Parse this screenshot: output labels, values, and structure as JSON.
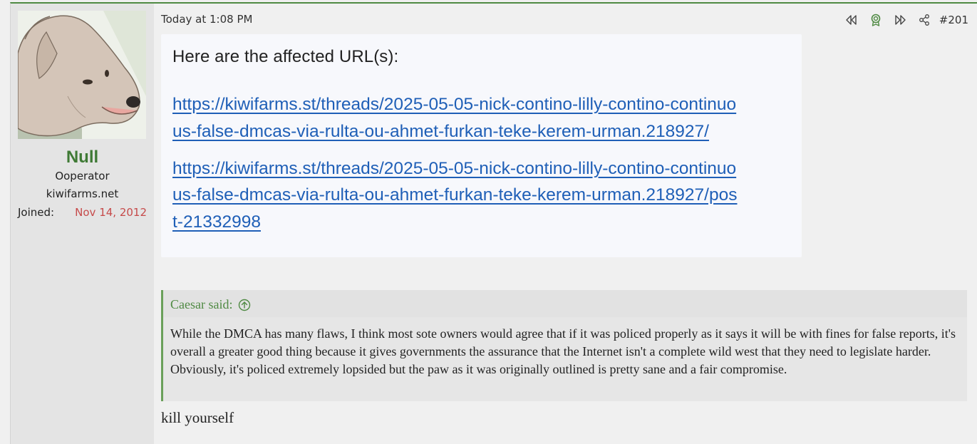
{
  "user": {
    "name": "Null",
    "title": "Ooperator",
    "site": "kiwifarms.net",
    "joined_label": "Joined:",
    "joined_value": "Nov 14, 2012"
  },
  "post": {
    "timestamp": "Today at 1:08 PM",
    "number": "#201",
    "icons": [
      "rewind-icon",
      "award-icon",
      "fast-forward-icon",
      "share-icon"
    ],
    "embed": {
      "heading": "Here are the affected URL(s):",
      "link1_line1": "https://kiwifarms.st/threads/2025-05-05-nick-contino-lilly-contino-continuo",
      "link1_line2": "us-false-dmcas-via-rulta-ou-ahmet-furkan-teke-kerem-urman.218927/",
      "link2_line1": "https://kiwifarms.st/threads/2025-05-05-nick-contino-lilly-contino-continuo",
      "link2_line2": "us-false-dmcas-via-rulta-ou-ahmet-furkan-teke-kerem-urman.218927/pos",
      "link2_line3": "t-21332998"
    },
    "quote": {
      "author": "Caesar said:",
      "text": "While the DMCA has many flaws, I think most sote owners would agree that if it was policed properly as it says it will be with fines for false reports, it's overall a greater good thing because it gives governments the assurance that the Internet isn't a complete wild west that they need to legislate harder. Obviously, it's policed extremely lopsided but the paw as it was originally outlined is pretty sane and a fair compromise."
    },
    "reply": "kill yourself"
  },
  "colors": {
    "accent_green": "#4f8a43",
    "joined_red": "#c64a4a",
    "link_blue": "#1f5fb7"
  }
}
